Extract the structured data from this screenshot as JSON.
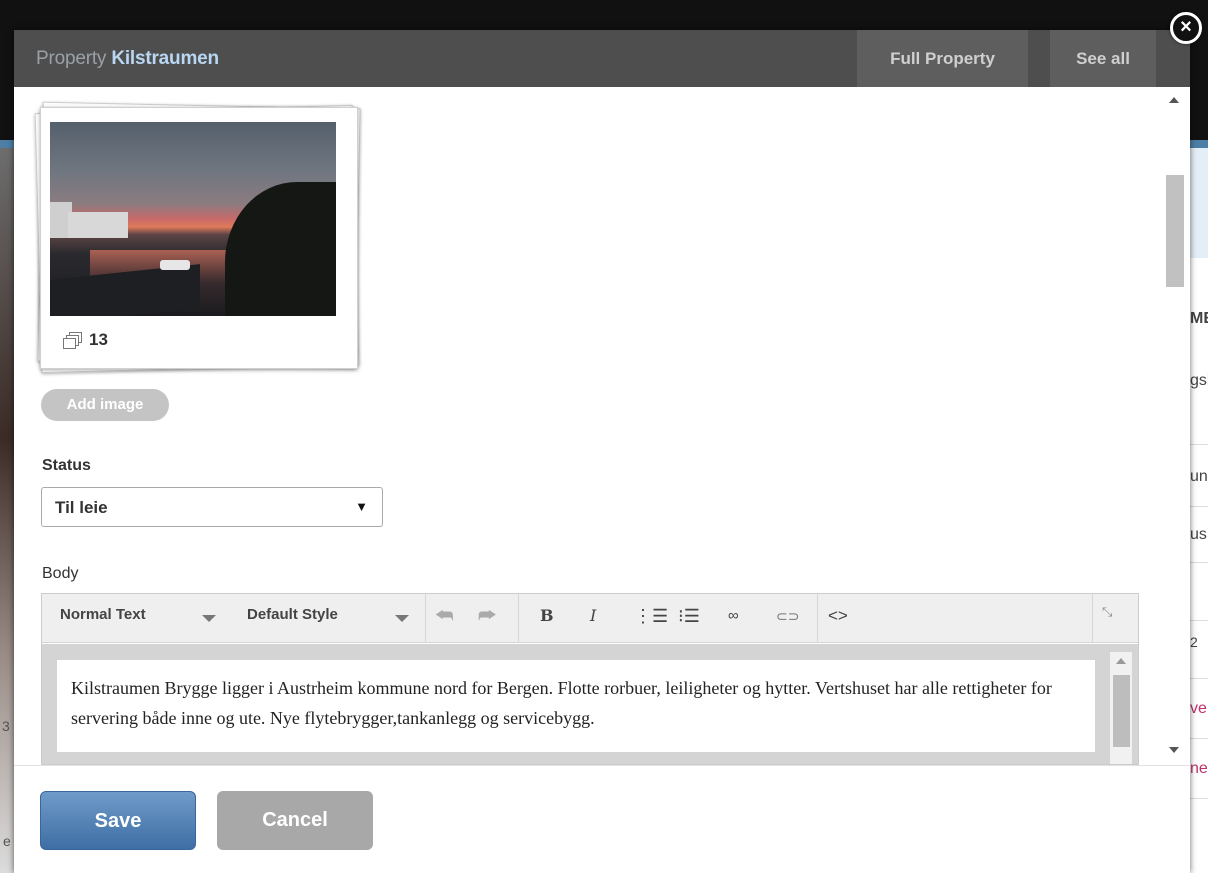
{
  "modal": {
    "title_prefix": "Property",
    "title_name": "Kilstraumen",
    "full_property_label": "Full Property",
    "see_all_label": "See all"
  },
  "gallery": {
    "count": "13",
    "add_image_label": "Add image"
  },
  "status": {
    "label": "Status",
    "selected": "Til leie"
  },
  "body": {
    "label": "Body",
    "toolbar": {
      "format_select": "Normal Text",
      "style_select": "Default Style",
      "icons": [
        "undo-icon",
        "redo-icon",
        "bold-icon",
        "italic-icon",
        "ordered-list-icon",
        "unordered-list-icon",
        "link-icon",
        "unlink-icon",
        "code-icon",
        "fullscreen-icon"
      ]
    },
    "text": "Kilstraumen Brygge ligger i Austrheim kommune nord for Bergen. Flotte rorbuer, leiligheter og hytter. Vertshuset har alle rettigheter for servering både inne og ute. Nye flytebrygger,tankanlegg og servicebygg."
  },
  "footer": {
    "save_label": "Save",
    "cancel_label": "Cancel"
  },
  "background": {
    "right_fragments": [
      "ME",
      "gsl",
      "un",
      "us",
      "",
      "2",
      "ve",
      "ne"
    ],
    "left_fragments": [
      "3",
      "e"
    ]
  },
  "colors": {
    "header_bg": "#4e4e4e",
    "title_accent": "#b9d6f2",
    "save_button": "#4f7eb3",
    "cancel_button": "#a8a8a8",
    "add_image_button": "#c4c4c4"
  }
}
